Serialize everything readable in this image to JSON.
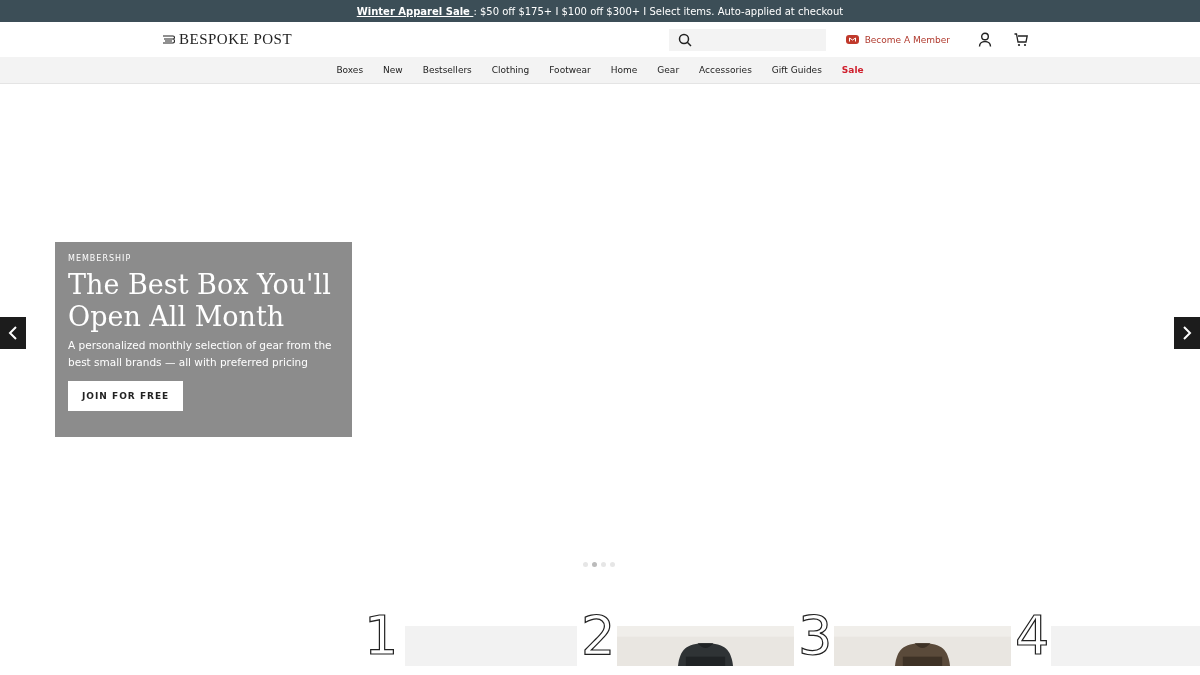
{
  "promo_bar": {
    "link": "Winter Apparel Sale ",
    "text": ": $50 off $175+ I $100 off $300+ I Select items. Auto-applied at checkout"
  },
  "header": {
    "logo": "BESPOKE POST",
    "member_link": "Become A Member"
  },
  "nav": [
    {
      "label": "Boxes",
      "kind": "normal"
    },
    {
      "label": "New",
      "kind": "normal"
    },
    {
      "label": "Bestsellers",
      "kind": "normal"
    },
    {
      "label": "Clothing",
      "kind": "normal"
    },
    {
      "label": "Footwear",
      "kind": "normal"
    },
    {
      "label": "Home",
      "kind": "normal"
    },
    {
      "label": "Gear",
      "kind": "normal"
    },
    {
      "label": "Accessories",
      "kind": "normal"
    },
    {
      "label": "Gift Guides",
      "kind": "normal"
    },
    {
      "label": "Sale",
      "kind": "sale"
    }
  ],
  "hero": {
    "eyebrow": "MEMBERSHIP",
    "title": "The Best Box You'll Open All Month",
    "text": "A personalized monthly selection of gear from the best small brands — all with preferred pricing",
    "button": "JOIN FOR FREE",
    "dots": [
      {
        "selected": false
      },
      {
        "selected": true
      },
      {
        "selected": false
      },
      {
        "selected": false
      }
    ]
  },
  "steps": [
    {
      "number": "1",
      "kind": "empty"
    },
    {
      "number": "2",
      "kind": "picture"
    },
    {
      "number": "3",
      "kind": "picture"
    },
    {
      "number": "4",
      "kind": "empty"
    }
  ]
}
